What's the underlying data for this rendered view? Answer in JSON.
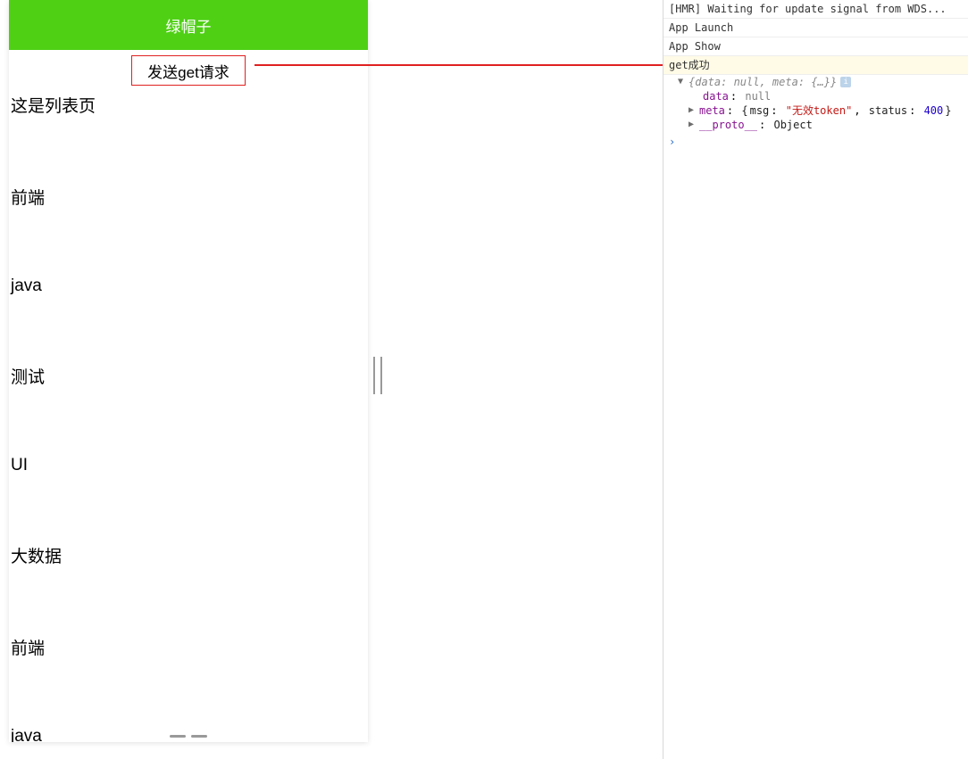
{
  "simulator": {
    "title": "绿帽子",
    "button_label": "发送get请求",
    "list_header": "这是列表页",
    "items": [
      "前端",
      "java",
      "测试",
      "UI",
      "大数据",
      "前端",
      "java"
    ]
  },
  "console": {
    "log_hmr": "[HMR] Waiting for update signal from WDS...",
    "log_launch": "App Launch",
    "log_show": "App Show",
    "log_get": "get成功",
    "obj_summary": "{data: null, meta: {…}}",
    "data_key": "data",
    "data_val": "null",
    "meta_key": "meta",
    "meta_msg_key": "msg",
    "meta_msg_val": "\"无效token\"",
    "meta_status_key": "status",
    "meta_status_val": "400",
    "proto_key": "__proto__",
    "proto_val": "Object",
    "prompt": "›"
  }
}
